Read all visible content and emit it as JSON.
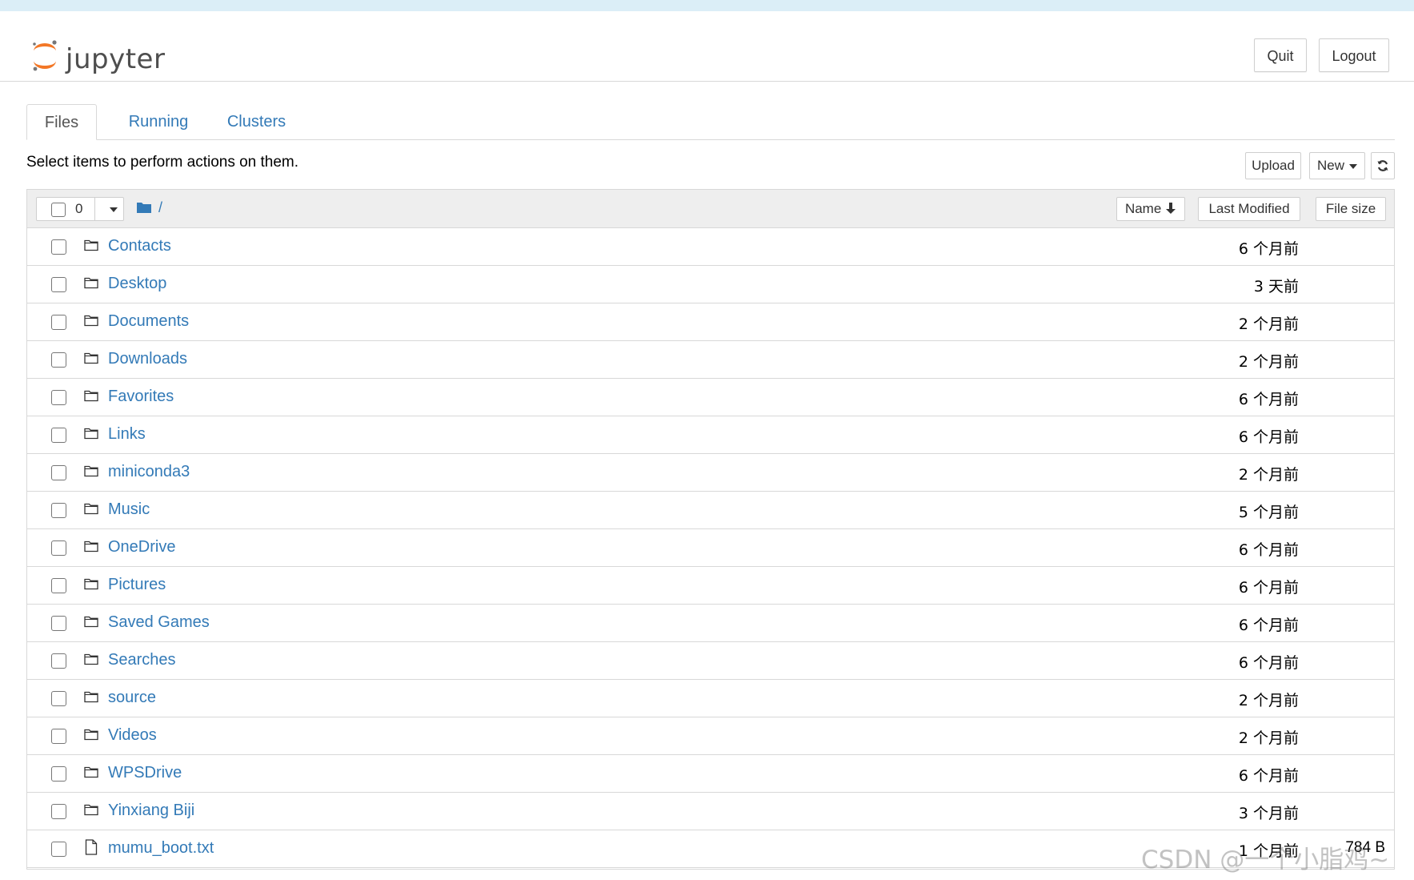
{
  "brand": {
    "name": "jupyter",
    "logo_icon": "jupyter-logo-icon"
  },
  "header": {
    "quit_label": "Quit",
    "logout_label": "Logout"
  },
  "tabs": [
    {
      "label": "Files",
      "active": true
    },
    {
      "label": "Running",
      "active": false
    },
    {
      "label": "Clusters",
      "active": false
    }
  ],
  "toolbar": {
    "instruction": "Select items to perform actions on them.",
    "upload_label": "Upload",
    "new_label": "New",
    "refresh_icon": "refresh-icon"
  },
  "list_header": {
    "selected_count": "0",
    "breadcrumb_sep": "/",
    "sort_name_label": "Name",
    "sort_modified_label": "Last Modified",
    "sort_size_label": "File size"
  },
  "files": [
    {
      "name": "Contacts",
      "type": "folder",
      "modified": "6 个月前",
      "size": ""
    },
    {
      "name": "Desktop",
      "type": "folder",
      "modified": "3 天前",
      "size": ""
    },
    {
      "name": "Documents",
      "type": "folder",
      "modified": "2 个月前",
      "size": ""
    },
    {
      "name": "Downloads",
      "type": "folder",
      "modified": "2 个月前",
      "size": ""
    },
    {
      "name": "Favorites",
      "type": "folder",
      "modified": "6 个月前",
      "size": ""
    },
    {
      "name": "Links",
      "type": "folder",
      "modified": "6 个月前",
      "size": ""
    },
    {
      "name": "miniconda3",
      "type": "folder",
      "modified": "2 个月前",
      "size": ""
    },
    {
      "name": "Music",
      "type": "folder",
      "modified": "5 个月前",
      "size": ""
    },
    {
      "name": "OneDrive",
      "type": "folder",
      "modified": "6 个月前",
      "size": ""
    },
    {
      "name": "Pictures",
      "type": "folder",
      "modified": "6 个月前",
      "size": ""
    },
    {
      "name": "Saved Games",
      "type": "folder",
      "modified": "6 个月前",
      "size": ""
    },
    {
      "name": "Searches",
      "type": "folder",
      "modified": "6 个月前",
      "size": ""
    },
    {
      "name": "source",
      "type": "folder",
      "modified": "2 个月前",
      "size": ""
    },
    {
      "name": "Videos",
      "type": "folder",
      "modified": "2 个月前",
      "size": ""
    },
    {
      "name": "WPSDrive",
      "type": "folder",
      "modified": "6 个月前",
      "size": ""
    },
    {
      "name": "Yinxiang Biji",
      "type": "folder",
      "modified": "3 个月前",
      "size": ""
    },
    {
      "name": "mumu_boot.txt",
      "type": "file",
      "modified": "1 个月前",
      "size": "784 B"
    }
  ],
  "watermark": "CSDN @一个小脂鸡~",
  "colors": {
    "link": "#337ab7",
    "topbar": "#dbeef7",
    "header_bg": "#eeeeee"
  }
}
